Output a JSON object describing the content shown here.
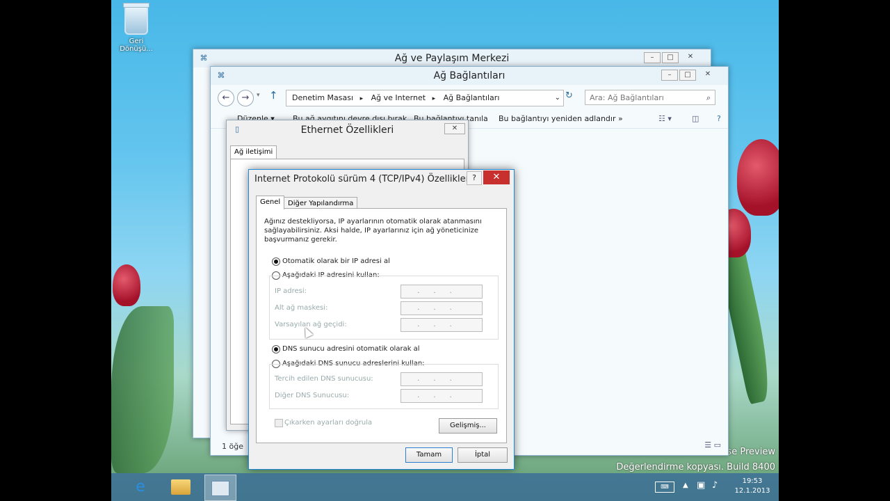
{
  "desktop": {
    "recycle_bin_label_line1": "Geri",
    "recycle_bin_label_line2": "Dönüşü...",
    "watermark_line1": "ase Preview",
    "watermark_line2": "Değerlendirme kopyası. Build 8400"
  },
  "window_network_center": {
    "title": "Ağ ve Paylaşım Merkezi"
  },
  "window_network_connections": {
    "title": "Ağ Bağlantıları",
    "breadcrumb": [
      "Denetim Masası",
      "Ağ ve Internet",
      "Ağ Bağlantıları"
    ],
    "search_placeholder": "Ara: Ağ Bağlantıları",
    "commands": {
      "organize": "Düzenle ▾",
      "disable": "Bu ağ aygıtını devre dışı bırak",
      "diagnose": "Bu bağlantıyı tanıla",
      "rename": "Bu bağlantıyı yeniden adlandır",
      "more": "»"
    },
    "status_count": "1 öğe"
  },
  "window_ethernet": {
    "title": "Ethernet Özellikleri",
    "tab": "Ağ iletişimi"
  },
  "tcpip_dialog": {
    "title": "Internet Protokolü sürüm 4 (TCP/IPv4) Özellikleri",
    "tabs": [
      "Genel",
      "Diğer Yapılandırma"
    ],
    "description": "Ağınız destekliyorsa, IP ayarlarının otomatik olarak atanmasını sağlayabilirsiniz. Aksi halde, IP ayarlarınız için ağ yöneticinize başvurmanız gerekir.",
    "ip_auto": "Otomatik olarak bir IP adresi al",
    "ip_manual": "Aşağıdaki IP adresini kullan:",
    "ip_address_label": "IP adresi:",
    "subnet_label": "Alt ağ maskesi:",
    "gateway_label": "Varsayılan ağ geçidi:",
    "dns_auto": "DNS sunucu adresini otomatik olarak al",
    "dns_manual": "Aşağıdaki DNS sunucu adreslerini kullan:",
    "dns_preferred_label": "Tercih edilen DNS sunucusu:",
    "dns_alternate_label": "Diğer DNS Sunucusu:",
    "ip_placeholder": "...",
    "validate_label": "Çıkarken ayarları doğrula",
    "advanced_button": "Gelişmiş...",
    "ok_button": "Tamam",
    "cancel_button": "İptal",
    "help_button": "?",
    "close_button": "✕"
  },
  "taskbar": {
    "time": "19:53",
    "date": "12.1.2013"
  },
  "colors": {
    "accent": "#1e8ad8",
    "close_red": "#c7302c"
  }
}
